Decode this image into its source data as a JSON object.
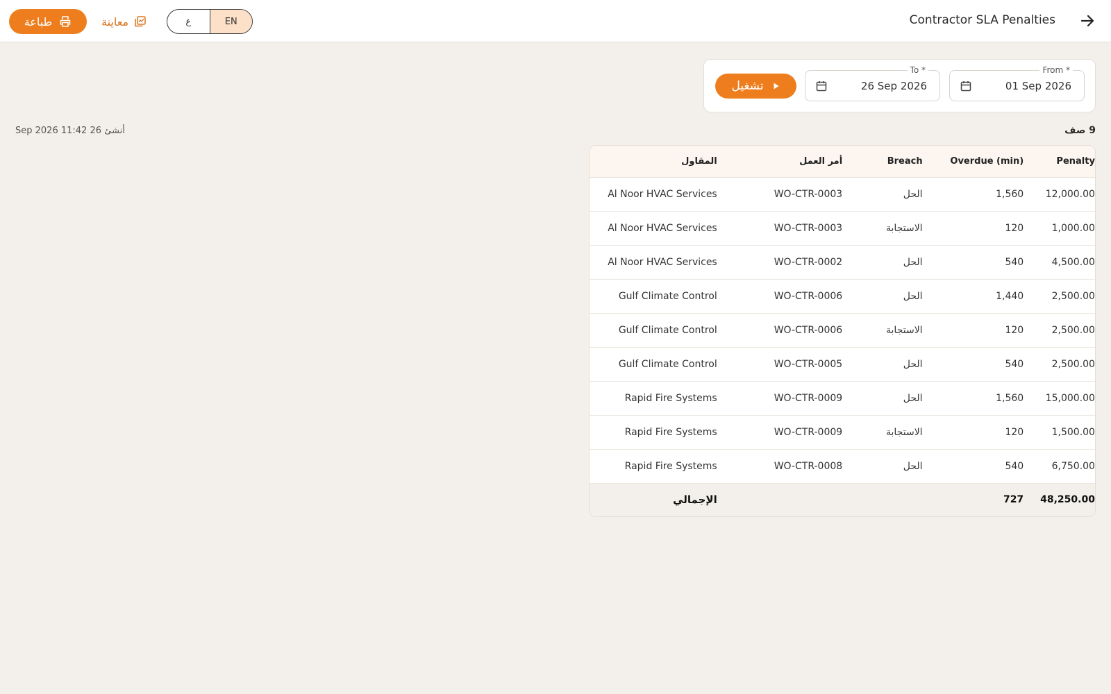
{
  "header": {
    "title": "Contractor SLA Penalties",
    "print_label": "طباعة",
    "preview_label": "معاينة",
    "lang_options": [
      "ع",
      "EN"
    ],
    "active_lang": "EN"
  },
  "filters": {
    "from_label": "From *",
    "from_value": "01 Sep 2026",
    "to_label": "To *",
    "to_value": "26 Sep 2026",
    "run_label": "تشغيل"
  },
  "summary": {
    "row_count": "9 صف",
    "generated": "أنشئ 26 Sep 2026 11:42"
  },
  "table": {
    "columns": {
      "contractor": "المقاول",
      "work_order": "أمر العمل",
      "breach": "Breach",
      "overdue": "Overdue (min)",
      "penalty": "Penalty"
    },
    "rows": [
      {
        "contractor": "Al Noor HVAC Services",
        "work_order": "WO-CTR-0003",
        "breach": "الحل",
        "overdue": "1,560",
        "penalty": "12,000.00"
      },
      {
        "contractor": "Al Noor HVAC Services",
        "work_order": "WO-CTR-0003",
        "breach": "الاستجابة",
        "overdue": "120",
        "penalty": "1,000.00"
      },
      {
        "contractor": "Al Noor HVAC Services",
        "work_order": "WO-CTR-0002",
        "breach": "الحل",
        "overdue": "540",
        "penalty": "4,500.00"
      },
      {
        "contractor": "Gulf Climate Control",
        "work_order": "WO-CTR-0006",
        "breach": "الحل",
        "overdue": "1,440",
        "penalty": "2,500.00"
      },
      {
        "contractor": "Gulf Climate Control",
        "work_order": "WO-CTR-0006",
        "breach": "الاستجابة",
        "overdue": "120",
        "penalty": "2,500.00"
      },
      {
        "contractor": "Gulf Climate Control",
        "work_order": "WO-CTR-0005",
        "breach": "الحل",
        "overdue": "540",
        "penalty": "2,500.00"
      },
      {
        "contractor": "Rapid Fire Systems",
        "work_order": "WO-CTR-0009",
        "breach": "الحل",
        "overdue": "1,560",
        "penalty": "15,000.00"
      },
      {
        "contractor": "Rapid Fire Systems",
        "work_order": "WO-CTR-0009",
        "breach": "الاستجابة",
        "overdue": "120",
        "penalty": "1,500.00"
      },
      {
        "contractor": "Rapid Fire Systems",
        "work_order": "WO-CTR-0008",
        "breach": "الحل",
        "overdue": "540",
        "penalty": "6,750.00"
      }
    ],
    "total": {
      "label": "الإجمالي",
      "overdue": "727",
      "penalty": "48,250.00"
    }
  },
  "colors": {
    "accent": "#ee7d1e",
    "background": "#f3f0eb",
    "header_row": "#fdf6f0"
  }
}
